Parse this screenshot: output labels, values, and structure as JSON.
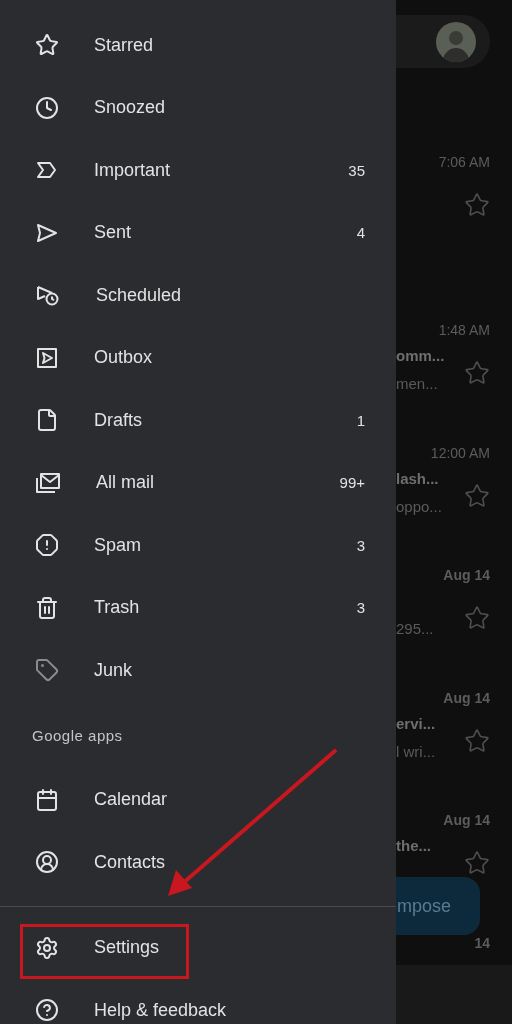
{
  "drawer": {
    "folders": [
      {
        "label": "Starred"
      },
      {
        "label": "Snoozed"
      },
      {
        "label": "Important",
        "count": "35"
      },
      {
        "label": "Sent",
        "count": "4"
      },
      {
        "label": "Scheduled"
      },
      {
        "label": "Outbox"
      },
      {
        "label": "Drafts",
        "count": "1"
      },
      {
        "label": "All mail",
        "count": "99+"
      },
      {
        "label": "Spam",
        "count": "3"
      },
      {
        "label": "Trash",
        "count": "3"
      },
      {
        "label": "Junk"
      }
    ],
    "google_apps": {
      "heading": "Google apps",
      "items": [
        {
          "label": "Calendar"
        },
        {
          "label": "Contacts"
        }
      ]
    },
    "footer_items": [
      {
        "label": "Settings",
        "highlighted": true
      },
      {
        "label": "Help & feedback",
        "highlighted": false
      }
    ]
  },
  "mail_list": [
    {
      "time": "7:06 AM"
    },
    {
      "time": "1:48 AM",
      "subject": "omm...",
      "snippet": "men..."
    },
    {
      "time": "12:00 AM",
      "subject": "lash...",
      "snippet": "oppo..."
    },
    {
      "time": "Aug 14",
      "snippet": "295..."
    },
    {
      "time": "Aug 14",
      "subject": "ervi...",
      "snippet": "l wri..."
    },
    {
      "time": "Aug 14",
      "subject": "the..."
    },
    {
      "time": "14"
    }
  ],
  "compose_button": {
    "label": "mpose"
  }
}
